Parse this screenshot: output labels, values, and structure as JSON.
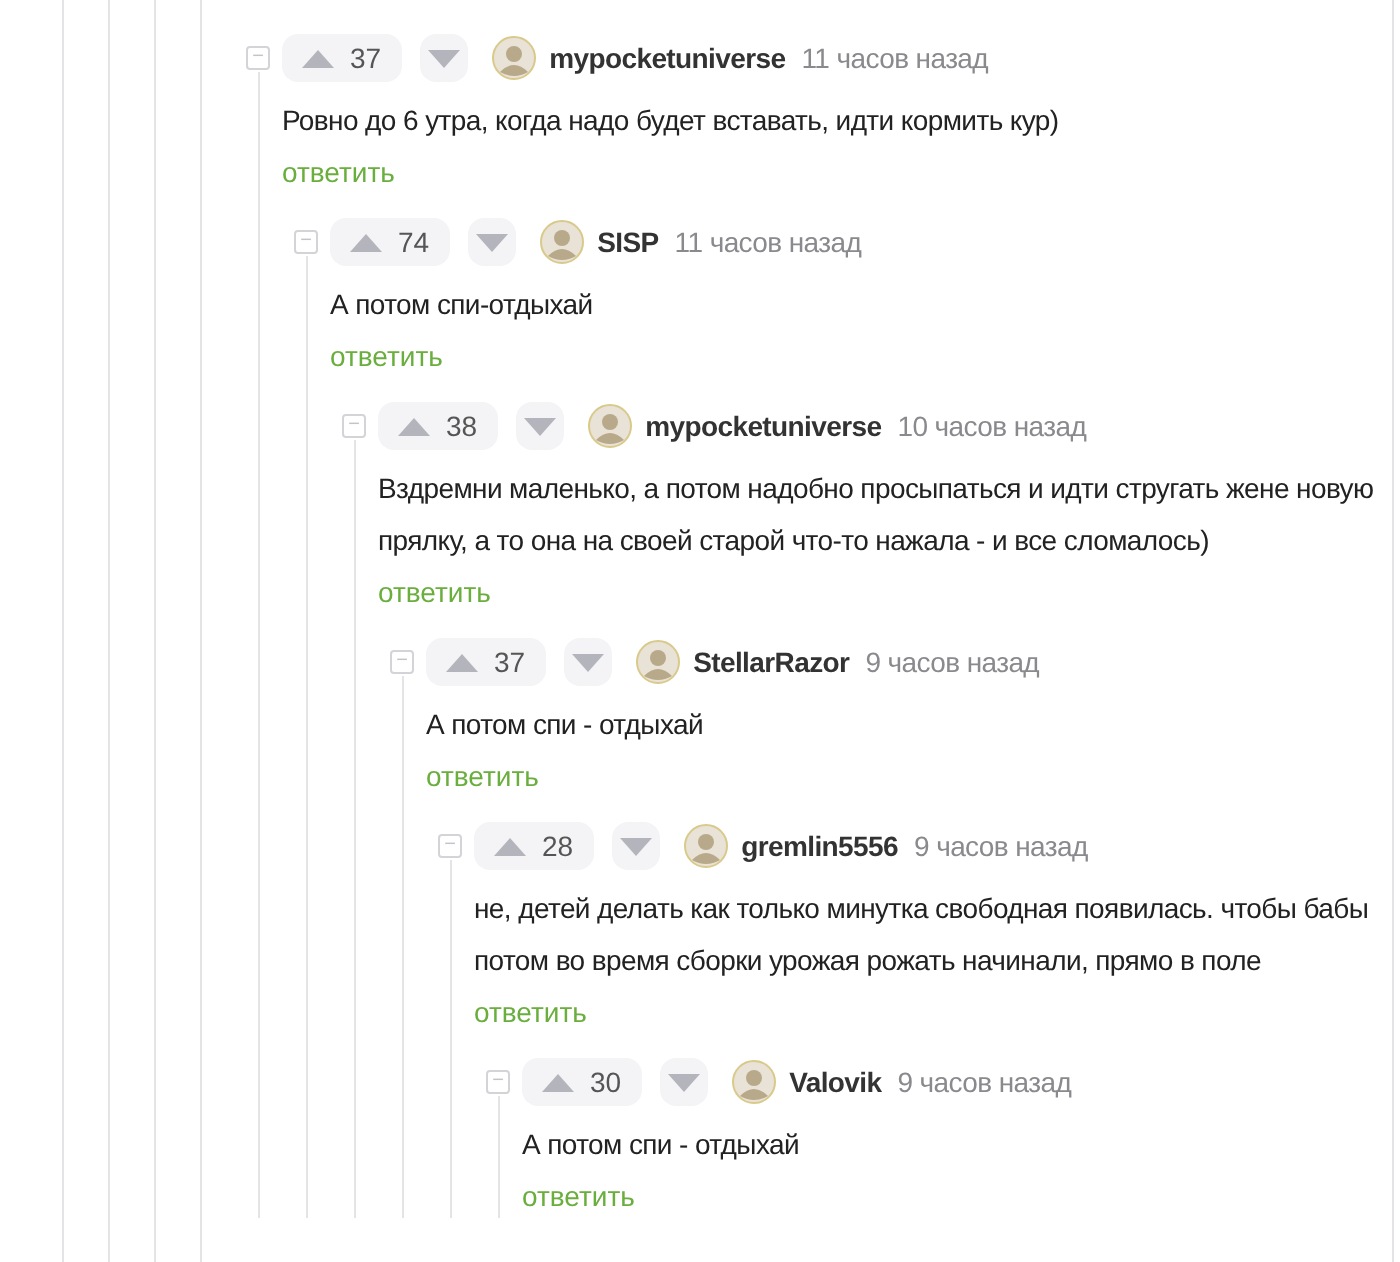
{
  "comments": [
    {
      "collapse": "−",
      "votes": "37",
      "author": "mypocketuniverse",
      "time": "11 часов назад",
      "text": "Ровно до 6 утра, когда надо будет вставать, идти кормить кур)",
      "reply": "ответить",
      "children": [
        {
          "collapse": "−",
          "votes": "74",
          "author": "SISP",
          "time": "11 часов назад",
          "text": "А потом спи-отдыхай",
          "reply": "ответить",
          "children": [
            {
              "collapse": "−",
              "votes": "38",
              "author": "mypocketuniverse",
              "time": "10 часов назад",
              "text": "Вздремни маленько, а потом надобно просыпаться и идти стругать жене новую прялку, а то она на своей старой что-то нажала - и все сломалось)",
              "reply": "ответить",
              "children": [
                {
                  "collapse": "−",
                  "votes": "37",
                  "author": "StellarRazor",
                  "time": "9 часов назад",
                  "text": "А потом спи - отдыхай",
                  "reply": "ответить",
                  "children": [
                    {
                      "collapse": "−",
                      "votes": "28",
                      "author": "gremlin5556",
                      "time": "9 часов назад",
                      "text": "не, детей делать как только минутка свободная появилась. чтобы бабы потом во время сборки урожая рожать начинали, прямо в поле",
                      "reply": "ответить",
                      "children": [
                        {
                          "collapse": "−",
                          "votes": "30",
                          "author": "Valovik",
                          "time": "9 часов назад",
                          "text": "А потом спи - отдыхай",
                          "reply": "ответить"
                        }
                      ]
                    }
                  ]
                }
              ]
            }
          ]
        }
      ]
    }
  ]
}
